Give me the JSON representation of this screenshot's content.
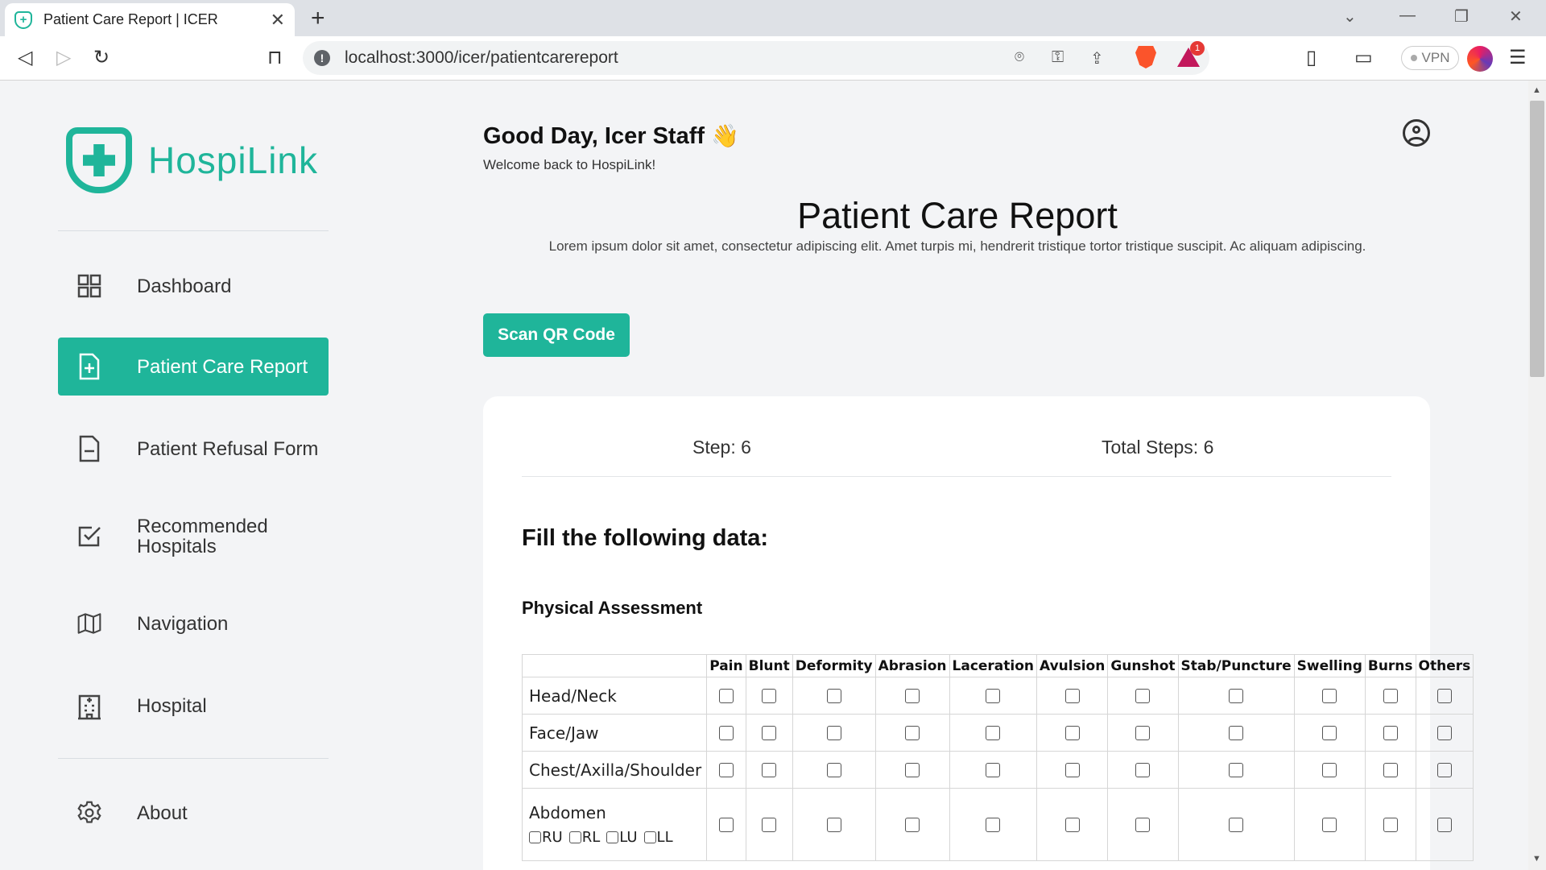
{
  "browser": {
    "tab_title": "Patient Care Report | ICER",
    "url": "localhost:3000/icer/patientcarereport",
    "vpn_label": "VPN",
    "rewards_badge": "1"
  },
  "sidebar": {
    "logo_text": "HospiLink",
    "items": [
      {
        "label": "Dashboard",
        "icon": "grid-icon"
      },
      {
        "label": "Patient Care Report",
        "icon": "file-plus-icon"
      },
      {
        "label": "Patient Refusal Form",
        "icon": "file-minus-icon"
      },
      {
        "label": "Recommended Hospitals",
        "icon": "checkbox-icon"
      },
      {
        "label": "Navigation",
        "icon": "map-icon"
      },
      {
        "label": "Hospital",
        "icon": "building-icon"
      },
      {
        "label": "About",
        "icon": "gear-icon"
      }
    ],
    "active_index": 1,
    "accent": "#1fb59a"
  },
  "header": {
    "greeting": "Good Day, Icer Staff",
    "greeting_emoji": "👋",
    "welcome": "Welcome back to HospiLink!"
  },
  "page": {
    "title": "Patient Care Report",
    "description": "Lorem ipsum dolor sit amet, consectetur adipiscing elit. Amet turpis mi, hendrerit tristique tortor tristique suscipit. Ac aliquam adipiscing.",
    "scan_button": "Scan QR Code"
  },
  "form": {
    "step": "Step: 6",
    "total_steps": "Total Steps: 6",
    "heading": "Fill the following data:",
    "section": "Physical Assessment",
    "columns": [
      "Pain",
      "Blunt",
      "Deformity",
      "Abrasion",
      "Laceration",
      "Avulsion",
      "Gunshot",
      "Stab/Puncture",
      "Swelling",
      "Burns",
      "Others"
    ],
    "rows": [
      "Head/Neck",
      "Face/Jaw",
      "Chest/Axilla/Shoulder",
      "Abdomen"
    ],
    "abdomen_quadrants": [
      "RU",
      "RL",
      "LU",
      "LL"
    ]
  }
}
